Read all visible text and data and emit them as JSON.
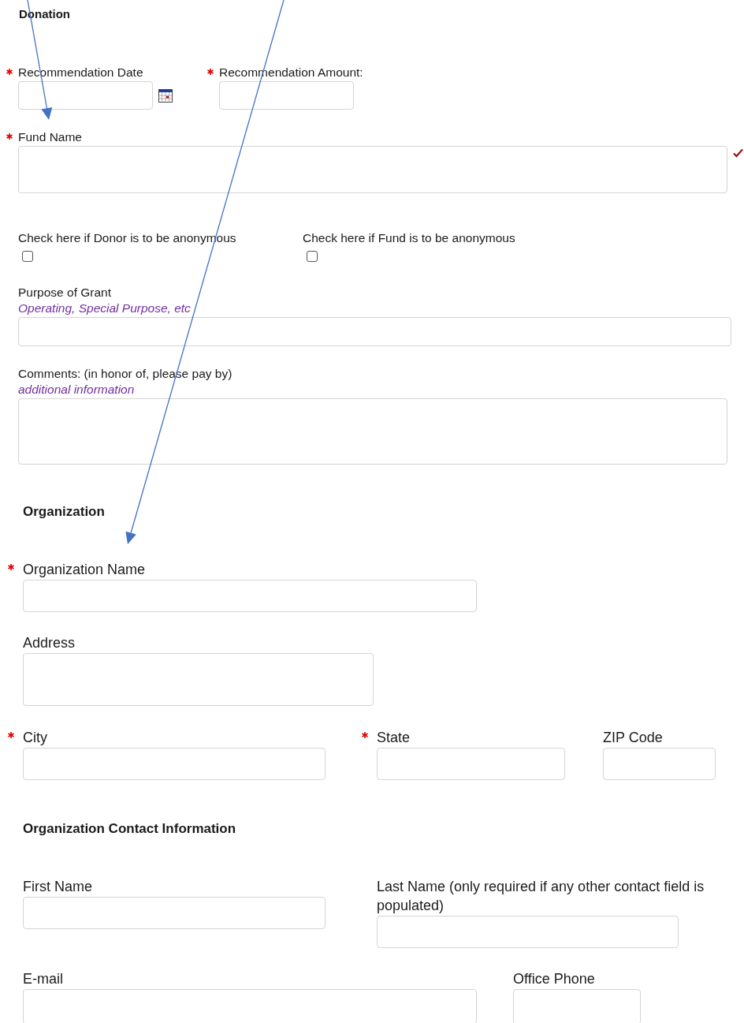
{
  "sections": [
    {
      "title": "Donation",
      "rows": [
        {
          "fields": [
            {
              "kind": "text",
              "label": "Recommendation Date",
              "required": true,
              "calendar": true
            },
            {
              "kind": "text",
              "label": "Recommendation Amount:",
              "required": true
            }
          ]
        },
        {
          "fields": [
            {
              "kind": "text",
              "label": "Fund Name",
              "required": true,
              "valid": true
            }
          ]
        },
        {
          "fields": [
            {
              "kind": "checkbox",
              "label": "Check here if Donor is to be anonymous",
              "checked": false
            },
            {
              "kind": "checkbox",
              "label": "Check here if Fund is to be anonymous",
              "checked": false
            }
          ]
        },
        {
          "fields": [
            {
              "kind": "text",
              "label": "Purpose of Grant",
              "hint": "Operating, Special Purpose, etc"
            }
          ]
        },
        {
          "fields": [
            {
              "kind": "textarea",
              "label": "Comments: (in honor of, please pay by)",
              "hint": "additional information"
            }
          ]
        }
      ]
    },
    {
      "title": "Organization",
      "rows": [
        {
          "fields": [
            {
              "kind": "text",
              "label": "Organization Name",
              "required": true
            }
          ]
        },
        {
          "fields": [
            {
              "kind": "textarea",
              "label": "Address"
            }
          ]
        },
        {
          "fields": [
            {
              "kind": "text",
              "label": "City",
              "required": true
            },
            {
              "kind": "text",
              "label": "State",
              "required": true
            },
            {
              "kind": "text",
              "label": "ZIP Code"
            }
          ]
        }
      ]
    },
    {
      "title": "Organization Contact Information",
      "rows": [
        {
          "fields": [
            {
              "kind": "text",
              "label": "First Name"
            },
            {
              "kind": "text",
              "label": "Last Name (only required if any other contact field is populated)"
            }
          ]
        },
        {
          "fields": [
            {
              "kind": "text",
              "label": "E-mail"
            },
            {
              "kind": "text",
              "label": "Office Phone"
            }
          ]
        }
      ]
    }
  ]
}
